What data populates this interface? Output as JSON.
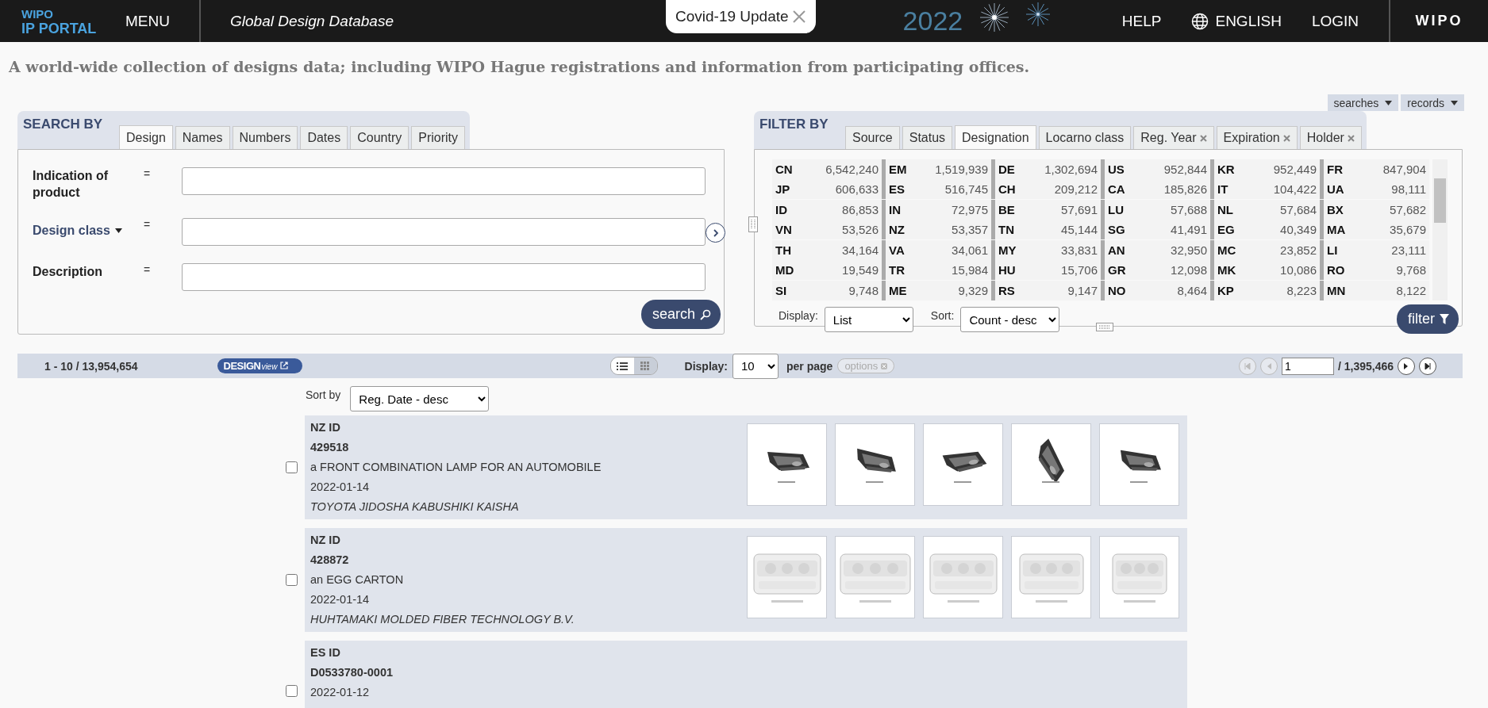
{
  "header": {
    "logo_top": "WIPO",
    "logo_bottom": "IP PORTAL",
    "menu": "MENU",
    "app_title": "Global Design Database",
    "notice": "Covid-19 Update",
    "banner_year": "2022",
    "nav": [
      {
        "label": "HELP",
        "kind": "text"
      },
      {
        "label": "ENGLISH",
        "kind": "globe"
      },
      {
        "label": "LOGIN",
        "kind": "text"
      }
    ],
    "brand": "WIPO"
  },
  "tagline": "A world-wide collection of designs data; including WIPO Hague registrations and information from participating offices.",
  "top_menus": [
    "searches",
    "records"
  ],
  "search": {
    "title": "SEARCH BY",
    "tabs": [
      {
        "label": "Design",
        "selected": true
      },
      {
        "label": "Names",
        "selected": false
      },
      {
        "label": "Numbers",
        "selected": false
      },
      {
        "label": "Dates",
        "selected": false
      },
      {
        "label": "Country",
        "selected": false
      },
      {
        "label": "Priority",
        "selected": false
      }
    ],
    "fields": [
      {
        "label": "Indication of product",
        "kind": "text"
      },
      {
        "label": "Design class",
        "kind": "dropdown"
      },
      {
        "label": "Description",
        "kind": "text"
      }
    ],
    "operator": "=",
    "button": "search"
  },
  "filter": {
    "title": "FILTER BY",
    "tabs": [
      {
        "label": "Source",
        "selected": false,
        "removable": false
      },
      {
        "label": "Status",
        "selected": false,
        "removable": false
      },
      {
        "label": "Designation",
        "selected": true,
        "removable": false
      },
      {
        "label": "Locarno class",
        "selected": false,
        "removable": false
      },
      {
        "label": "Reg. Year",
        "selected": false,
        "removable": true
      },
      {
        "label": "Expiration",
        "selected": false,
        "removable": true
      },
      {
        "label": "Holder",
        "selected": false,
        "removable": true
      }
    ],
    "counts": [
      {
        "code": "CN",
        "count": "6,542,240"
      },
      {
        "code": "EM",
        "count": "1,519,939"
      },
      {
        "code": "DE",
        "count": "1,302,694"
      },
      {
        "code": "US",
        "count": "952,844"
      },
      {
        "code": "KR",
        "count": "952,449"
      },
      {
        "code": "FR",
        "count": "847,904"
      },
      {
        "code": "JP",
        "count": "606,633"
      },
      {
        "code": "ES",
        "count": "516,745"
      },
      {
        "code": "CH",
        "count": "209,212"
      },
      {
        "code": "CA",
        "count": "185,826"
      },
      {
        "code": "IT",
        "count": "104,422"
      },
      {
        "code": "UA",
        "count": "98,111"
      },
      {
        "code": "ID",
        "count": "86,853"
      },
      {
        "code": "IN",
        "count": "72,975"
      },
      {
        "code": "BE",
        "count": "57,691"
      },
      {
        "code": "LU",
        "count": "57,688"
      },
      {
        "code": "NL",
        "count": "57,684"
      },
      {
        "code": "BX",
        "count": "57,682"
      },
      {
        "code": "VN",
        "count": "53,526"
      },
      {
        "code": "NZ",
        "count": "53,357"
      },
      {
        "code": "TN",
        "count": "45,144"
      },
      {
        "code": "SG",
        "count": "41,491"
      },
      {
        "code": "EG",
        "count": "40,349"
      },
      {
        "code": "MA",
        "count": "35,679"
      },
      {
        "code": "TH",
        "count": "34,164"
      },
      {
        "code": "VA",
        "count": "34,061"
      },
      {
        "code": "MY",
        "count": "33,831"
      },
      {
        "code": "AN",
        "count": "32,950"
      },
      {
        "code": "MC",
        "count": "23,852"
      },
      {
        "code": "LI",
        "count": "23,111"
      },
      {
        "code": "MD",
        "count": "19,549"
      },
      {
        "code": "TR",
        "count": "15,984"
      },
      {
        "code": "HU",
        "count": "15,706"
      },
      {
        "code": "GR",
        "count": "12,098"
      },
      {
        "code": "MK",
        "count": "10,086"
      },
      {
        "code": "RO",
        "count": "9,768"
      },
      {
        "code": "SI",
        "count": "9,748"
      },
      {
        "code": "ME",
        "count": "9,329"
      },
      {
        "code": "RS",
        "count": "9,147"
      },
      {
        "code": "NO",
        "count": "8,464"
      },
      {
        "code": "KP",
        "count": "8,223"
      },
      {
        "code": "MN",
        "count": "8,122"
      }
    ],
    "display_label": "Display:",
    "display_value": "List",
    "sort_label": "Sort:",
    "sort_value": "Count - desc",
    "button": "filter"
  },
  "results_bar": {
    "range": "1 - 10 / 13,954,654",
    "badge_main": "DESIGN",
    "badge_sub": "view",
    "views": [
      {
        "kind": "list",
        "selected": true
      },
      {
        "kind": "grid",
        "selected": false
      }
    ],
    "display_label": "Display:",
    "per_page_value": "10",
    "per_page_label": "per page",
    "options": "options",
    "page": "1",
    "total_pages": "/ 1,395,466"
  },
  "sort": {
    "label": "Sort by",
    "value": "Reg. Date - desc"
  },
  "results": [
    {
      "office": "NZ ID",
      "number": "429518",
      "title": "a FRONT COMBINATION LAMP FOR AN AUTOMOBILE",
      "date": "2022-01-14",
      "holder": "TOYOTA JIDOSHA KABUSHIKI KAISHA",
      "checked": false
    },
    {
      "office": "NZ ID",
      "number": "428872",
      "title": "an EGG CARTON",
      "date": "2022-01-14",
      "holder": "HUHTAMAKI MOLDED FIBER TECHNOLOGY B.V.",
      "checked": false
    },
    {
      "office": "ES ID",
      "number": "D0533780-0001",
      "date": "2022-01-12",
      "checked": false
    }
  ]
}
